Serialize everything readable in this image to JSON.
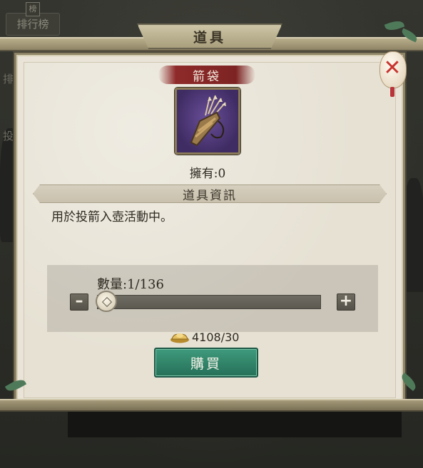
{
  "background": {
    "rank_tab_label": "排行榜",
    "rank_tab_seal": "榜",
    "side_text_1": "排",
    "side_text_2": "投"
  },
  "dialog": {
    "title": "道具",
    "close_icon": "close-lantern-icon"
  },
  "item": {
    "name": "箭袋",
    "icon": "quiver-icon",
    "owned_text": "擁有:0",
    "section_title": "道具資訊",
    "description": "用於投箭入壺活動中。"
  },
  "quantity": {
    "label": "數量:1/136",
    "current": 1,
    "max": 136,
    "minus_icon": "minus-icon",
    "plus_icon": "plus-icon"
  },
  "price": {
    "currency_icon": "gold-ingot-icon",
    "text": "4108/30"
  },
  "buy_button": {
    "label": "購買",
    "color": "#2f8468"
  }
}
